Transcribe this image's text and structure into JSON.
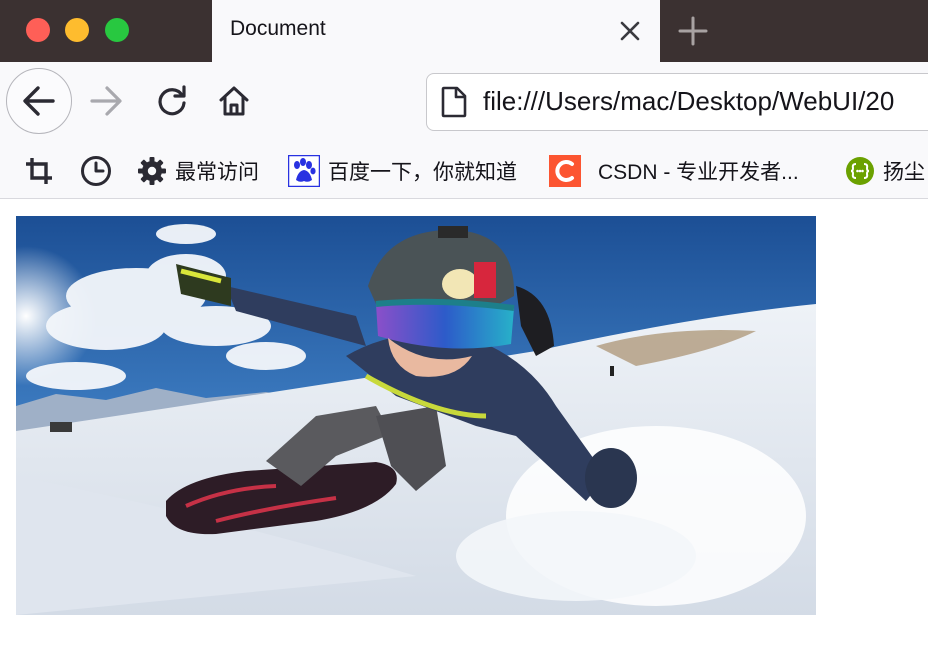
{
  "window": {
    "tab_title": "Document"
  },
  "toolbar": {
    "url": "file:///Users/mac/Desktop/WebUI/20"
  },
  "bookmarks": {
    "items": [
      {
        "label": "最常访问",
        "icon": "gear-icon"
      },
      {
        "label": "百度一下，你就知道",
        "icon": "baidu-paw-icon"
      },
      {
        "label": "CSDN - 专业开发者...",
        "icon": "csdn-logo-icon"
      },
      {
        "label": "扬尘",
        "icon": "braces-icon"
      }
    ]
  },
  "content": {
    "image_subject": "snowboarder-photo"
  },
  "colors": {
    "titlebar": "#3b3131",
    "close": "#fe5f57",
    "minimize": "#febc2e",
    "maximize": "#28c840",
    "baidu": "#2932e1",
    "csdn": "#fc5531",
    "yangchen": "#6ba100"
  }
}
